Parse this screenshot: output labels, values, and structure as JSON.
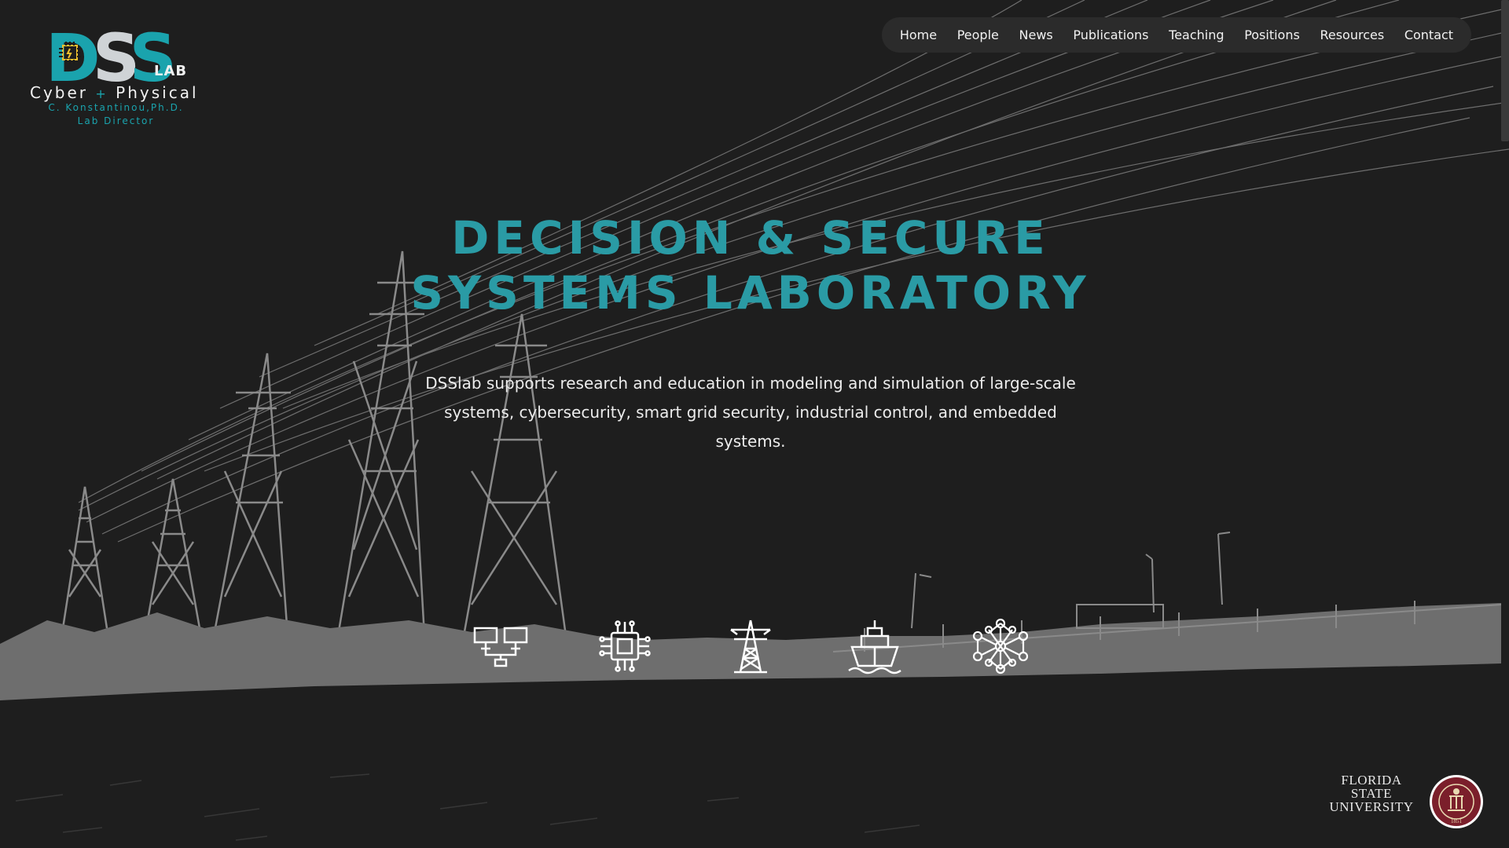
{
  "logo": {
    "mark_d": "D",
    "mark_s1": "S",
    "mark_s2": "S",
    "lab": "LAB",
    "cyber": "Cyber",
    "plus": "+",
    "physical": "Physical",
    "director_name": "C. Konstantinou,Ph.D.",
    "director_title": "Lab Director"
  },
  "nav": {
    "items": [
      "Home",
      "People",
      "News",
      "Publications",
      "Teaching",
      "Positions",
      "Resources",
      "Contact"
    ]
  },
  "hero": {
    "title_line1": "DECISION & SECURE",
    "title_line2": "SYSTEMS LABORATORY",
    "description": "DSSlab supports research and education in modeling and simulation of large-scale systems, cybersecurity, smart grid security, industrial control, and embedded systems."
  },
  "research_icons": [
    "network-icon",
    "cpu-chip-icon",
    "power-tower-icon",
    "ship-icon",
    "mesh-network-icon"
  ],
  "footer": {
    "university_line1": "FLORIDA STATE",
    "university_line2": "UNIVERSITY",
    "seal_year": "1851"
  },
  "colors": {
    "background": "#1e1e1e",
    "accent": "#2a9ba5",
    "nav_bg": "#2b2b2b",
    "ground": "#6e6e6e",
    "seal": "#7b1f2b"
  }
}
